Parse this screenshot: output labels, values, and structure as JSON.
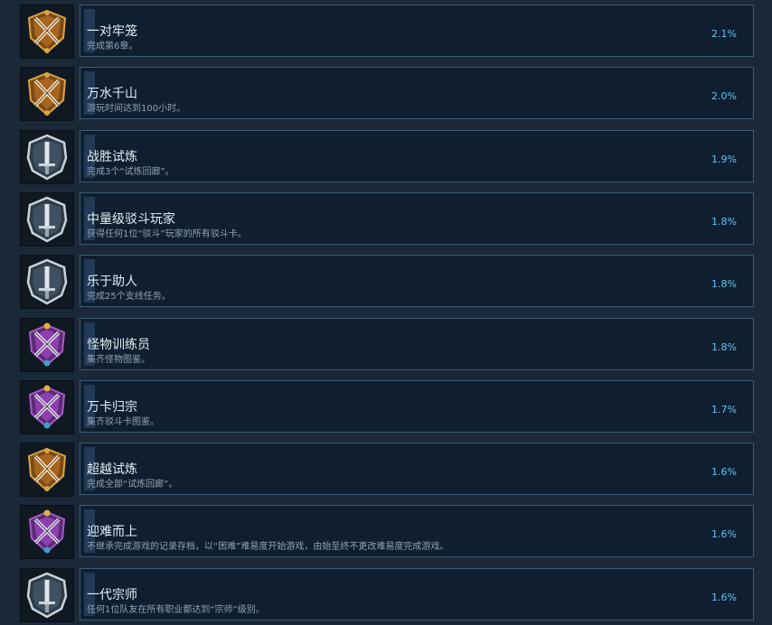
{
  "achievements": [
    {
      "title": "一对牢笼",
      "description": "完成第6章。",
      "percent": "2.1%",
      "icon": "gold-crossed-swords-emblem-icon",
      "icon_style": "gold"
    },
    {
      "title": "万水千山",
      "description": "游玩时间达到100小时。",
      "percent": "2.0%",
      "icon": "gold-crossed-swords-emblem-icon",
      "icon_style": "gold"
    },
    {
      "title": "战胜试炼",
      "description": "完成3个“试炼回廊”。",
      "percent": "1.9%",
      "icon": "silver-sword-emblem-icon",
      "icon_style": "silver"
    },
    {
      "title": "中量级驳斗玩家",
      "description": "获得任何1位“驳斗”玩家的所有驳斗卡。",
      "percent": "1.8%",
      "icon": "silver-sword-emblem-icon",
      "icon_style": "silver"
    },
    {
      "title": "乐于助人",
      "description": "完成25个支线任务。",
      "percent": "1.8%",
      "icon": "silver-sword-emblem-icon",
      "icon_style": "silver"
    },
    {
      "title": "怪物训练员",
      "description": "集齐怪物图鉴。",
      "percent": "1.8%",
      "icon": "purple-crossed-swords-emblem-icon",
      "icon_style": "purple"
    },
    {
      "title": "万卡归宗",
      "description": "集齐驳斗卡图鉴。",
      "percent": "1.7%",
      "icon": "purple-crossed-swords-emblem-icon",
      "icon_style": "purple"
    },
    {
      "title": "超越试炼",
      "description": "完成全部“试炼回廊”。",
      "percent": "1.6%",
      "icon": "gold-crossed-swords-emblem-icon",
      "icon_style": "gold"
    },
    {
      "title": "迎难而上",
      "description": "不继承完成游戏的记录存档，以“困难”难易度开始游戏，由始至终不更改难易度完成游戏。",
      "percent": "1.6%",
      "icon": "purple-crossed-swords-emblem-icon",
      "icon_style": "purple"
    },
    {
      "title": "一代宗师",
      "description": "任何1位队友在所有职业都达到“宗师”级别。",
      "percent": "1.6%",
      "icon": "silver-sword-emblem-icon",
      "icon_style": "silver"
    }
  ],
  "colors": {
    "background": "#1b2838",
    "panel": "#0f1f2f",
    "panel_border": "#3a5a72",
    "percent_text": "#66c0f4",
    "gold": "#d9a441",
    "silver": "#c9d4dc",
    "purple": "#a65bc6"
  }
}
